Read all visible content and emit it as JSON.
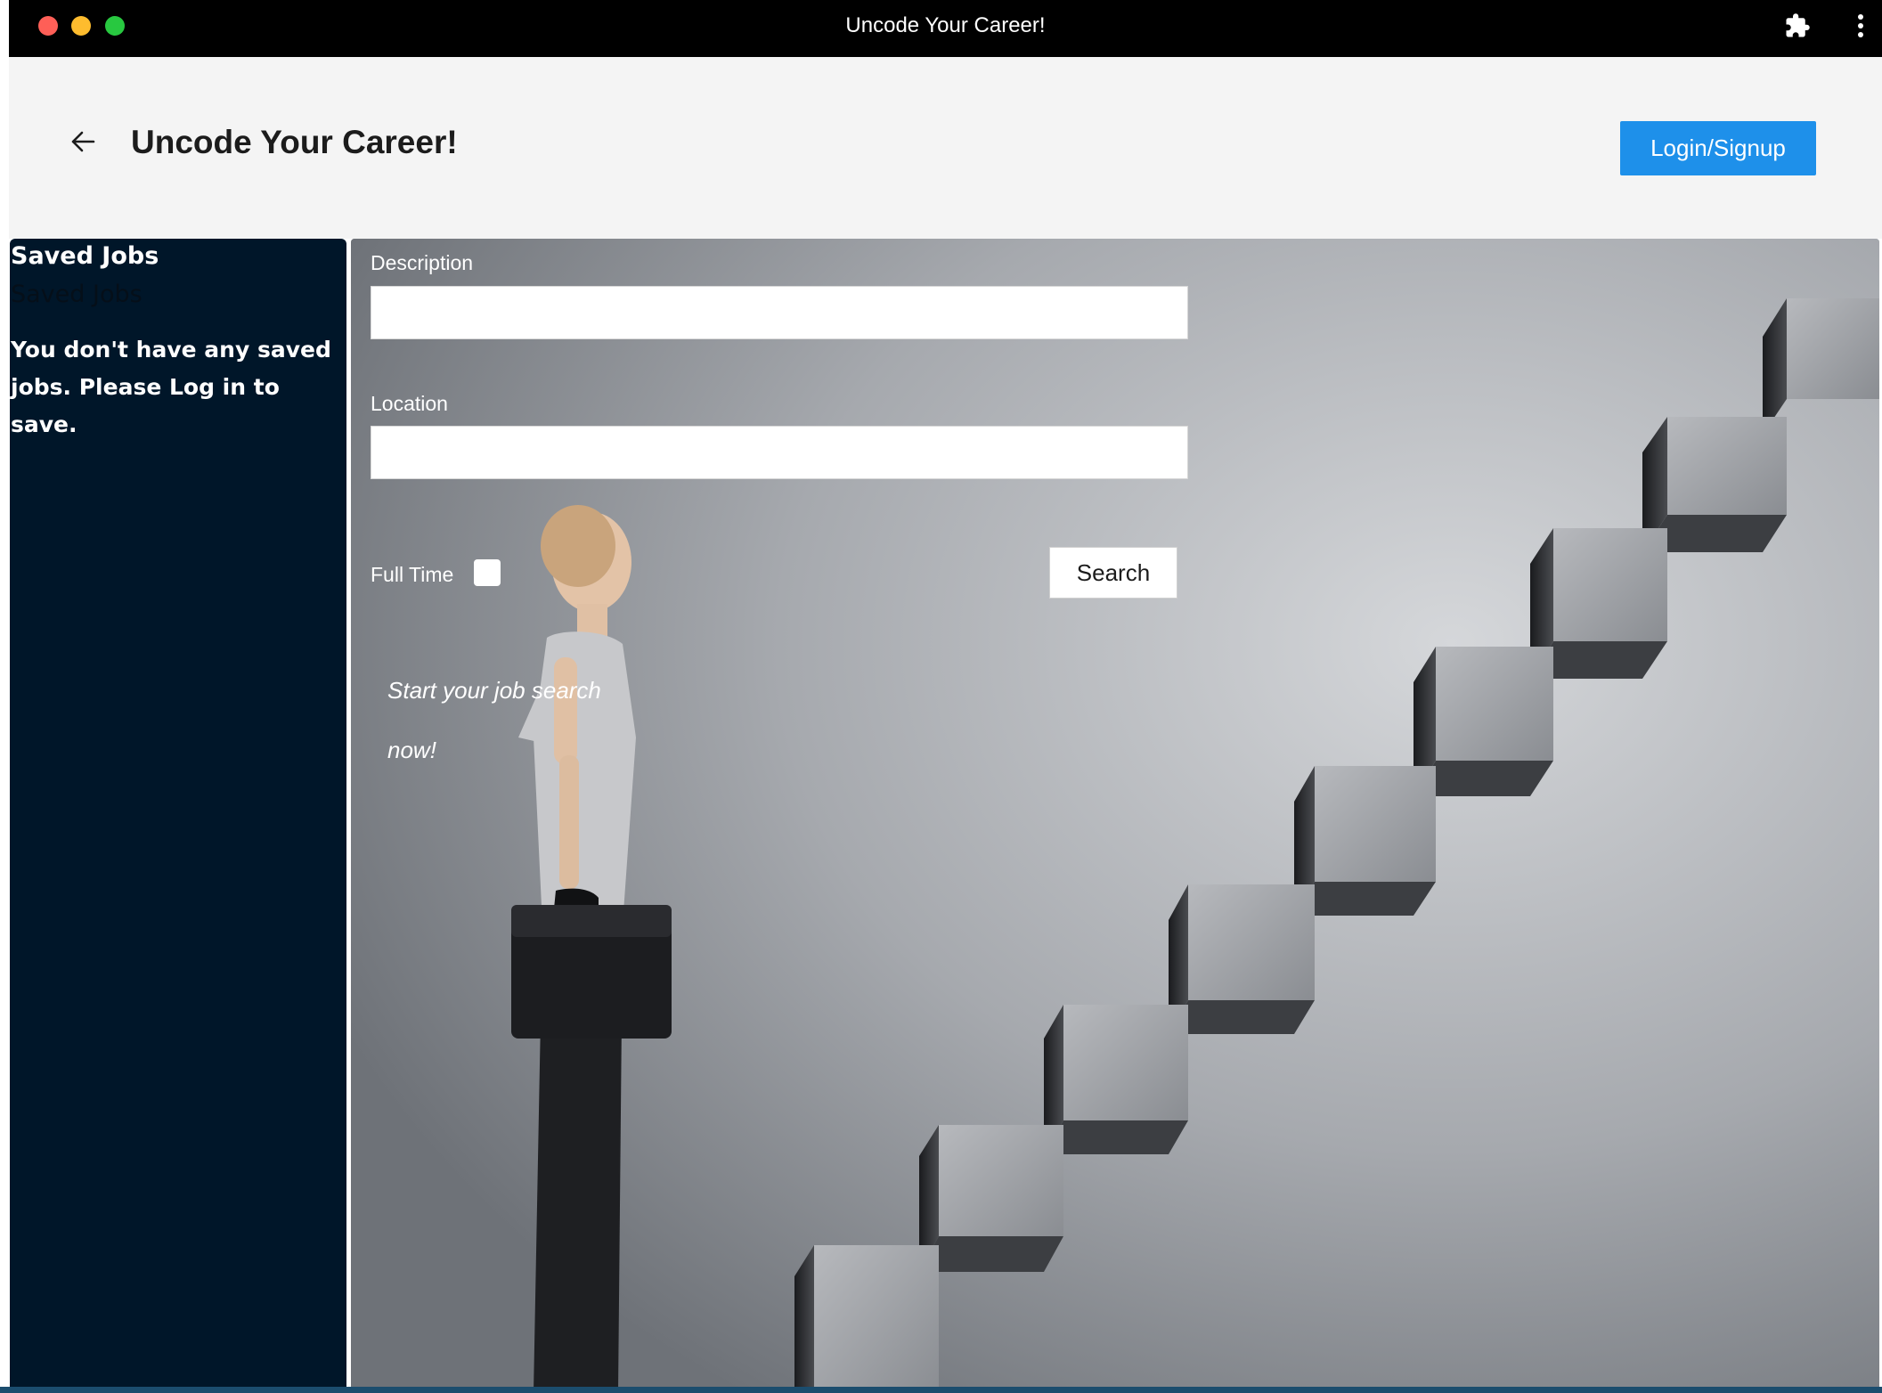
{
  "window": {
    "title": "Uncode Your Career!",
    "traffic_lights": {
      "close_color": "#fe5f57",
      "minimize_color": "#febc2e",
      "zoom_color": "#28c840"
    },
    "extensions_icon": "puzzle-piece-icon",
    "menu_icon": "vertical-dots-icon"
  },
  "header": {
    "back_icon": "arrow-left-icon",
    "title": "Uncode Your Career!",
    "login_label": "Login/Signup"
  },
  "sidebar": {
    "heading": "Saved Jobs",
    "subheading": "Saved Jobs",
    "empty_message": "You don't have any saved jobs. Please Log in to save."
  },
  "search": {
    "description_label": "Description",
    "description_value": "",
    "location_label": "Location",
    "location_value": "",
    "fulltime_label": "Full Time",
    "fulltime_checked": false,
    "search_label": "Search"
  },
  "hero": {
    "tagline": "Start your job search now!"
  },
  "colors": {
    "titlebar": "#000000",
    "header_bg": "#f4f4f4",
    "primary_button": "#1e90ea",
    "sidebar_bg": "#001629",
    "wall": "#9fa2a8"
  }
}
